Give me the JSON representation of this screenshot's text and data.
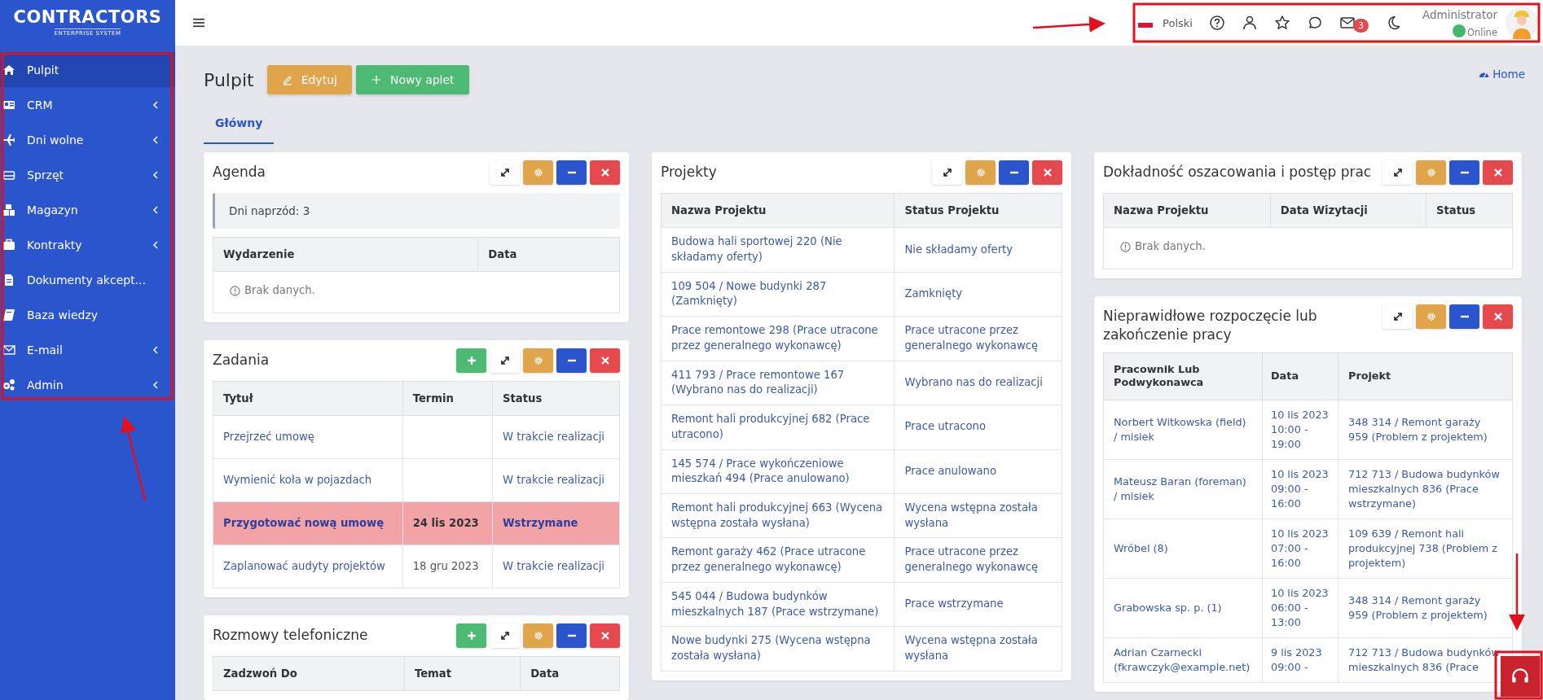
{
  "sidebar": {
    "logo": {
      "title": "CONTRACTORS",
      "subtitle": "ENTERPRISE SYSTEM"
    },
    "items": [
      {
        "label": "Pulpit",
        "selected": true,
        "has_submenu": false
      },
      {
        "label": "CRM",
        "selected": false,
        "has_submenu": true
      },
      {
        "label": "Dni wolne",
        "selected": false,
        "has_submenu": true
      },
      {
        "label": "Sprzęt",
        "selected": false,
        "has_submenu": true
      },
      {
        "label": "Magazyn",
        "selected": false,
        "has_submenu": true
      },
      {
        "label": "Kontrakty",
        "selected": false,
        "has_submenu": true
      },
      {
        "label": "Dokumenty akcept...",
        "selected": false,
        "has_submenu": false
      },
      {
        "label": "Baza wiedzy",
        "selected": false,
        "has_submenu": false
      },
      {
        "label": "E-mail",
        "selected": false,
        "has_submenu": true
      },
      {
        "label": "Admin",
        "selected": false,
        "has_submenu": true
      }
    ]
  },
  "topbar": {
    "language": "Polski",
    "mail_count": "3",
    "user": {
      "name": "Administrator",
      "status": "Online"
    }
  },
  "page": {
    "title": "Pulpit",
    "buttons": [
      {
        "label": "Edytuj",
        "kind": "edit"
      },
      {
        "label": "Nowy aplet",
        "kind": "add"
      }
    ],
    "breadcrumb": "Home"
  },
  "tabs": [
    {
      "label": "Główny",
      "selected": true
    }
  ],
  "columns": [
    [
      {
        "title": "Agenda",
        "has_add": false,
        "info": "Dni naprzód: 3",
        "table": {
          "columns": [
            {
              "label": "Wydarzenie"
            },
            {
              "label": "Data"
            }
          ],
          "empty": "Brak danych."
        }
      },
      {
        "title": "Zadania",
        "has_add": true,
        "table": {
          "columns": [
            {
              "label": "Tytuł",
              "kind": "link"
            },
            {
              "label": "Termin",
              "kind": "text"
            },
            {
              "label": "Status",
              "kind": "link"
            }
          ],
          "rows": [
            {
              "cells": [
                "Przejrzeć umowę",
                null,
                "W trakcie realizacji"
              ],
              "highlighted": false
            },
            {
              "cells": [
                "Wymienić koła w pojazdach",
                null,
                "W trakcie realizacji"
              ],
              "highlighted": false
            },
            {
              "cells": [
                "Przygotować nową umowę",
                "24 lis 2023",
                "Wstrzymane"
              ],
              "highlighted": true
            },
            {
              "cells": [
                "Zaplanować audyty projektów",
                "18 gru 2023",
                "W trakcie realizacji"
              ],
              "highlighted": false
            }
          ]
        }
      },
      {
        "title": "Rozmowy telefoniczne",
        "has_add": true,
        "table": {
          "columns": [
            {
              "label": "Zadzwoń Do"
            },
            {
              "label": "Temat"
            },
            {
              "label": "Data"
            }
          ]
        }
      }
    ],
    [
      {
        "title": "Projekty",
        "has_add": false,
        "table": {
          "columns": [
            {
              "label": "Nazwa Projektu",
              "kind": "link"
            },
            {
              "label": "Status Projektu",
              "kind": "link"
            }
          ],
          "rows": [
            {
              "cells": [
                "Budowa hali sportowej 220 (Nie składamy oferty)",
                "Nie składamy oferty"
              ],
              "highlighted": false
            },
            {
              "cells": [
                "109 504 / Nowe budynki 287 (Zamknięty)",
                "Zamknięty"
              ],
              "highlighted": false
            },
            {
              "cells": [
                "Prace remontowe 298 (Prace utracone przez generalnego wykonawcę)",
                "Prace utracone przez generalnego wykonawcę"
              ],
              "highlighted": false
            },
            {
              "cells": [
                "411 793 / Prace remontowe 167 (Wybrano nas do realizacji)",
                "Wybrano nas do realizacji"
              ],
              "highlighted": false
            },
            {
              "cells": [
                "Remont hali produkcyjnej 682 (Prace utracono)",
                "Prace utracono"
              ],
              "highlighted": false
            },
            {
              "cells": [
                "145 574 / Prace wykończeniowe mieszkań 494 (Prace anulowano)",
                "Prace anulowano"
              ],
              "highlighted": false
            },
            {
              "cells": [
                "Remont hali produkcyjnej 663 (Wycena wstępna została wysłana)",
                "Wycena wstępna została wysłana"
              ],
              "highlighted": false
            },
            {
              "cells": [
                "Remont garaży 462 (Prace utracone przez generalnego wykonawcę)",
                "Prace utracone przez generalnego wykonawcę"
              ],
              "highlighted": false
            },
            {
              "cells": [
                "545 044 / Budowa budynków mieszkalnych 187 (Prace wstrzymane)",
                "Prace wstrzymane"
              ],
              "highlighted": false
            },
            {
              "cells": [
                "Nowe budynki 275 (Wycena wstępna została wysłana)",
                "Wycena wstępna została wysłana"
              ],
              "highlighted": false
            }
          ]
        }
      }
    ],
    [
      {
        "title": "Dokładność oszacowania i postęp prac",
        "has_add": false,
        "table": {
          "columns": [
            {
              "label": "Nazwa Projektu"
            },
            {
              "label": "Data Wizytacji"
            },
            {
              "label": "Status"
            }
          ],
          "empty": "Brak danych."
        }
      },
      {
        "title": "Nieprawidłowe rozpoczęcie lub zakończenie pracy",
        "has_add": false,
        "table": {
          "columns": [
            {
              "label": "Pracownik Lub Podwykonawca",
              "kind": "link"
            },
            {
              "label": "Data",
              "kind": "link"
            },
            {
              "label": "Projekt",
              "kind": "link"
            }
          ],
          "rows": [
            {
              "cells": [
                "Norbert Witkowska (field) / misiek",
                "10 lis 2023 10:00 - 19:00",
                "348 314 / Remont garaży 959 (Problem z projektem)"
              ],
              "highlighted": false
            },
            {
              "cells": [
                "Mateusz Baran (foreman) / misiek",
                "10 lis 2023 09:00 - 16:00",
                "712 713 / Budowa budynków mieszkalnych 836 (Prace wstrzymane)"
              ],
              "highlighted": false
            },
            {
              "cells": [
                "Wróbel (8)",
                "10 lis 2023 07:00 - 16:00",
                "109 639 / Remont hali produkcyjnej 738 (Problem z projektem)"
              ],
              "highlighted": false
            },
            {
              "cells": [
                "Grabowska sp. p. (1)",
                "10 lis 2023 06:00 - 13:00",
                "348 314 / Remont garaży 959 (Problem z projektem)"
              ],
              "highlighted": false
            },
            {
              "cells": [
                "Adrian Czarnecki (fkrawczyk@example.net)",
                "9 lis 2023 09:00 -",
                "712 713 / Budowa budynków mieszkalnych 836 (Prace"
              ],
              "highlighted": false
            }
          ]
        }
      }
    ]
  ]
}
